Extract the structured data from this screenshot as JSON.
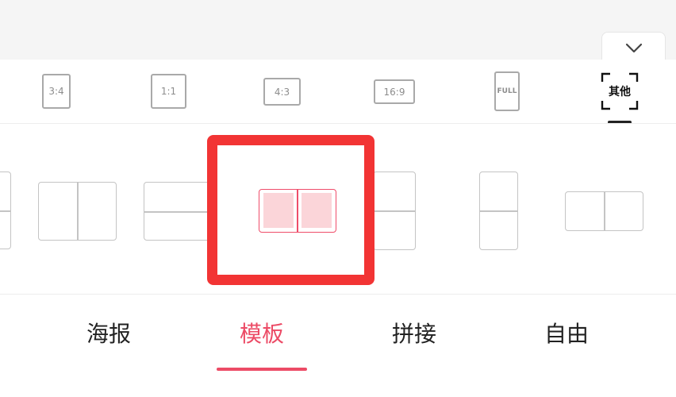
{
  "ratio_options": [
    {
      "label": "3:4"
    },
    {
      "label": "1:1"
    },
    {
      "label": "4:3"
    },
    {
      "label": "16:9"
    },
    {
      "label": "FULL"
    }
  ],
  "other_option": {
    "label": "其他",
    "selected": true
  },
  "collapse_button": {
    "icon": "chevron-down-icon"
  },
  "layouts": {
    "selected_index": 3,
    "items": [
      {
        "name": "layout-partial-left"
      },
      {
        "name": "layout-two-columns"
      },
      {
        "name": "layout-two-rows"
      },
      {
        "name": "layout-two-columns-selected"
      },
      {
        "name": "layout-two-rows-tall"
      },
      {
        "name": "layout-two-rows-narrow"
      },
      {
        "name": "layout-two-columns-wide"
      }
    ]
  },
  "tabs": [
    {
      "label": "海报"
    },
    {
      "label": "模板",
      "active": true
    },
    {
      "label": "拼接"
    },
    {
      "label": "自由"
    }
  ],
  "colors": {
    "accent": "#ec4b66",
    "highlight_border": "#f23434",
    "selected_fill": "#fbd5d9"
  }
}
